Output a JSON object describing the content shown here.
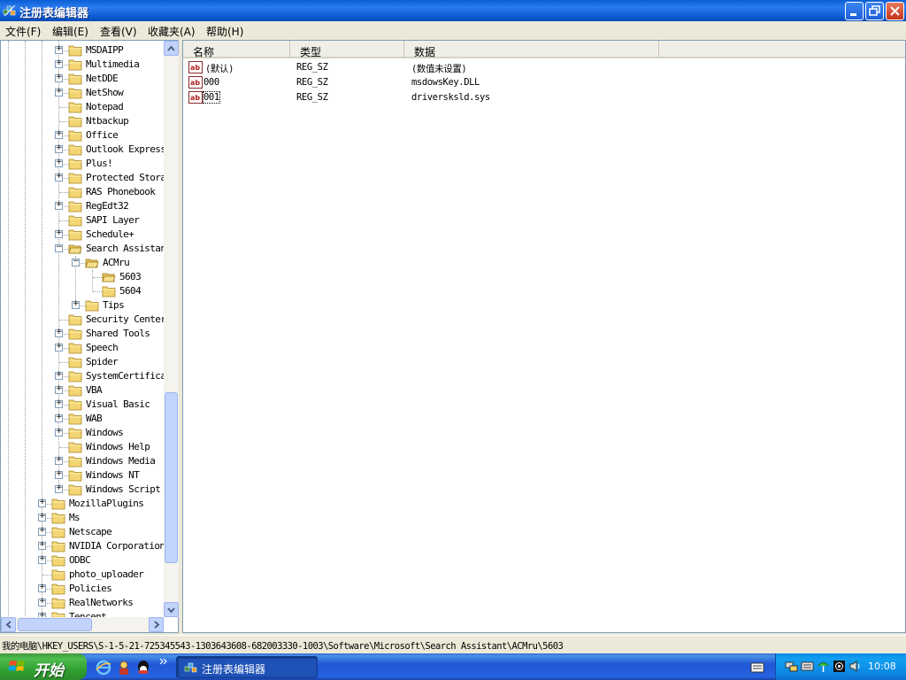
{
  "window": {
    "title": "注册表编辑器",
    "minimize": "minimize",
    "maximize": "restore",
    "close": "close"
  },
  "menu": [
    {
      "label": "文件(F)"
    },
    {
      "label": "编辑(E)"
    },
    {
      "label": "查看(V)"
    },
    {
      "label": "收藏夹(A)"
    },
    {
      "label": "帮助(H)"
    }
  ],
  "tree": {
    "items": [
      {
        "label": "MSDAIPP",
        "expander": "+"
      },
      {
        "label": "Multimedia",
        "expander": "+"
      },
      {
        "label": "NetDDE",
        "expander": "+"
      },
      {
        "label": "NetShow",
        "expander": "+"
      },
      {
        "label": "Notepad",
        "expander": ""
      },
      {
        "label": "Ntbackup",
        "expander": ""
      },
      {
        "label": "Office",
        "expander": "+"
      },
      {
        "label": "Outlook Express",
        "expander": "+"
      },
      {
        "label": "Plus!",
        "expander": "+"
      },
      {
        "label": "Protected Storage",
        "expander": "+"
      },
      {
        "label": "RAS Phonebook",
        "expander": ""
      },
      {
        "label": "RegEdt32",
        "expander": "+"
      },
      {
        "label": "SAPI Layer",
        "expander": ""
      },
      {
        "label": "Schedule+",
        "expander": "+"
      },
      {
        "label": "Search Assistant",
        "expander": "-"
      },
      {
        "label": "ACMru",
        "expander": "-"
      },
      {
        "label": "5603",
        "expander": ""
      },
      {
        "label": "5604",
        "expander": ""
      },
      {
        "label": "Tips",
        "expander": "+"
      },
      {
        "label": "Security Center",
        "expander": ""
      },
      {
        "label": "Shared Tools",
        "expander": "+"
      },
      {
        "label": "Speech",
        "expander": "+"
      },
      {
        "label": "Spider",
        "expander": ""
      },
      {
        "label": "SystemCertificates",
        "expander": "+"
      },
      {
        "label": "VBA",
        "expander": "+"
      },
      {
        "label": "Visual Basic",
        "expander": "+"
      },
      {
        "label": "WAB",
        "expander": "+"
      },
      {
        "label": "Windows",
        "expander": "+"
      },
      {
        "label": "Windows Help",
        "expander": ""
      },
      {
        "label": "Windows Media",
        "expander": "+"
      },
      {
        "label": "Windows NT",
        "expander": "+"
      },
      {
        "label": "Windows Script",
        "expander": "+"
      },
      {
        "label": "MozillaPlugins",
        "expander": "+"
      },
      {
        "label": "Ms",
        "expander": "+"
      },
      {
        "label": "Netscape",
        "expander": "+"
      },
      {
        "label": "NVIDIA Corporation",
        "expander": "+"
      },
      {
        "label": "ODBC",
        "expander": "+"
      },
      {
        "label": "photo_uploader",
        "expander": ""
      },
      {
        "label": "Policies",
        "expander": "+"
      },
      {
        "label": "RealNetworks",
        "expander": "+"
      },
      {
        "label": "Tencent",
        "expander": "+"
      }
    ]
  },
  "list": {
    "columns": [
      "名称",
      "类型",
      "数据"
    ],
    "rows": [
      {
        "name": "(默认)",
        "type": "REG_SZ",
        "data": "(数值未设置)"
      },
      {
        "name": "000",
        "type": "REG_SZ",
        "data": "msdowsKey.DLL"
      },
      {
        "name": "001",
        "type": "REG_SZ",
        "data": "driversksld.sys"
      }
    ]
  },
  "status": {
    "path": "我的电脑\\HKEY_USERS\\S-1-5-21-725345543-1303643608-682003330-1003\\Software\\Microsoft\\Search Assistant\\ACMru\\5603"
  },
  "taskbar": {
    "start_label": "开始",
    "task_label": "注册表编辑器",
    "clock": "10:08",
    "quicklaunch": [
      "ie-icon",
      "app-icon",
      "qq-icon"
    ],
    "tray_icons": [
      "network-icon",
      "keyboard-icon",
      "wifi-icon",
      "media-icon",
      "volume-icon"
    ]
  },
  "colors": {
    "titlebar": "#0a5fd6",
    "taskbar": "#2157d7",
    "start": "#3c9a3c",
    "tray": "#0e8ae8"
  }
}
